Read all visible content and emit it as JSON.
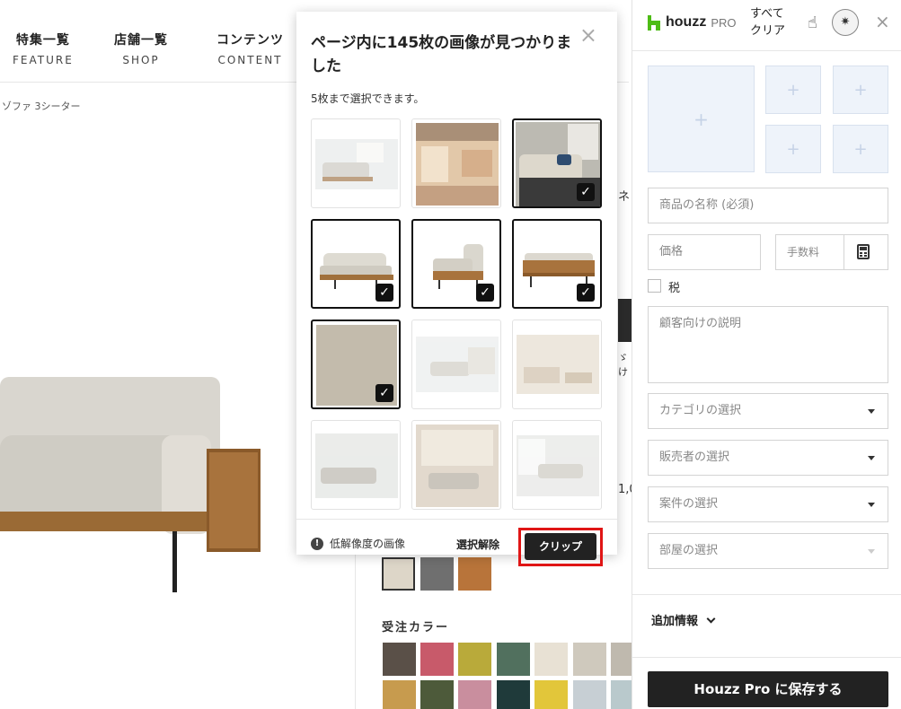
{
  "store": {
    "nav": [
      {
        "ja": "特集一覧",
        "en": "FEATURE"
      },
      {
        "ja": "店舗一覧",
        "en": "SHOP"
      },
      {
        "ja": "コンテンツ",
        "en": "CONTENT"
      }
    ],
    "breadcrumb": "ゾファ 3シーター",
    "color_label": "受注カラー",
    "partial_texts": [
      "ネ",
      "ゞけ",
      "1,0"
    ]
  },
  "popup": {
    "title": "ページ内に145枚の画像が見つかりました",
    "subtitle": "5枚まで選択できます。",
    "close_icon": "×",
    "selected_count": 5,
    "thumbnails": [
      {
        "name": "sofa-room-1",
        "selected": false
      },
      {
        "name": "shop-interior",
        "selected": false
      },
      {
        "name": "sofa-cushions",
        "selected": true
      },
      {
        "name": "sofa-front",
        "selected": true
      },
      {
        "name": "sofa-side",
        "selected": true
      },
      {
        "name": "sofa-back",
        "selected": true
      },
      {
        "name": "fabric-texture",
        "selected": true
      },
      {
        "name": "sofa-room-2",
        "selected": false
      },
      {
        "name": "living-room-1",
        "selected": false
      },
      {
        "name": "living-room-2",
        "selected": false
      },
      {
        "name": "living-room-3",
        "selected": false
      },
      {
        "name": "sofa-window",
        "selected": false
      }
    ],
    "lowres_label": "低解像度の画像",
    "deselect_label": "選択解除",
    "clip_label": "クリップ"
  },
  "panel": {
    "logo_word": "houzz",
    "logo_pro": "PRO",
    "clear_all": "すべてクリア",
    "close_icon": "×",
    "name_placeholder": "商品の名称 (必須)",
    "price_placeholder": "価格",
    "fee_placeholder": "手数料",
    "tax_label": "税",
    "description_placeholder": "顧客向けの説明",
    "category_select": "カテゴリの選択",
    "vendor_select": "販売者の選択",
    "project_select": "案件の選択",
    "room_select": "部屋の選択",
    "more_info": "追加情報",
    "save_label": "Houzz Pro に保存する"
  },
  "colors": {
    "brand_green": "#4dbc15",
    "dark_button": "#222222",
    "highlight_red": "#e01515",
    "upload_bg": "#eef3fa"
  }
}
